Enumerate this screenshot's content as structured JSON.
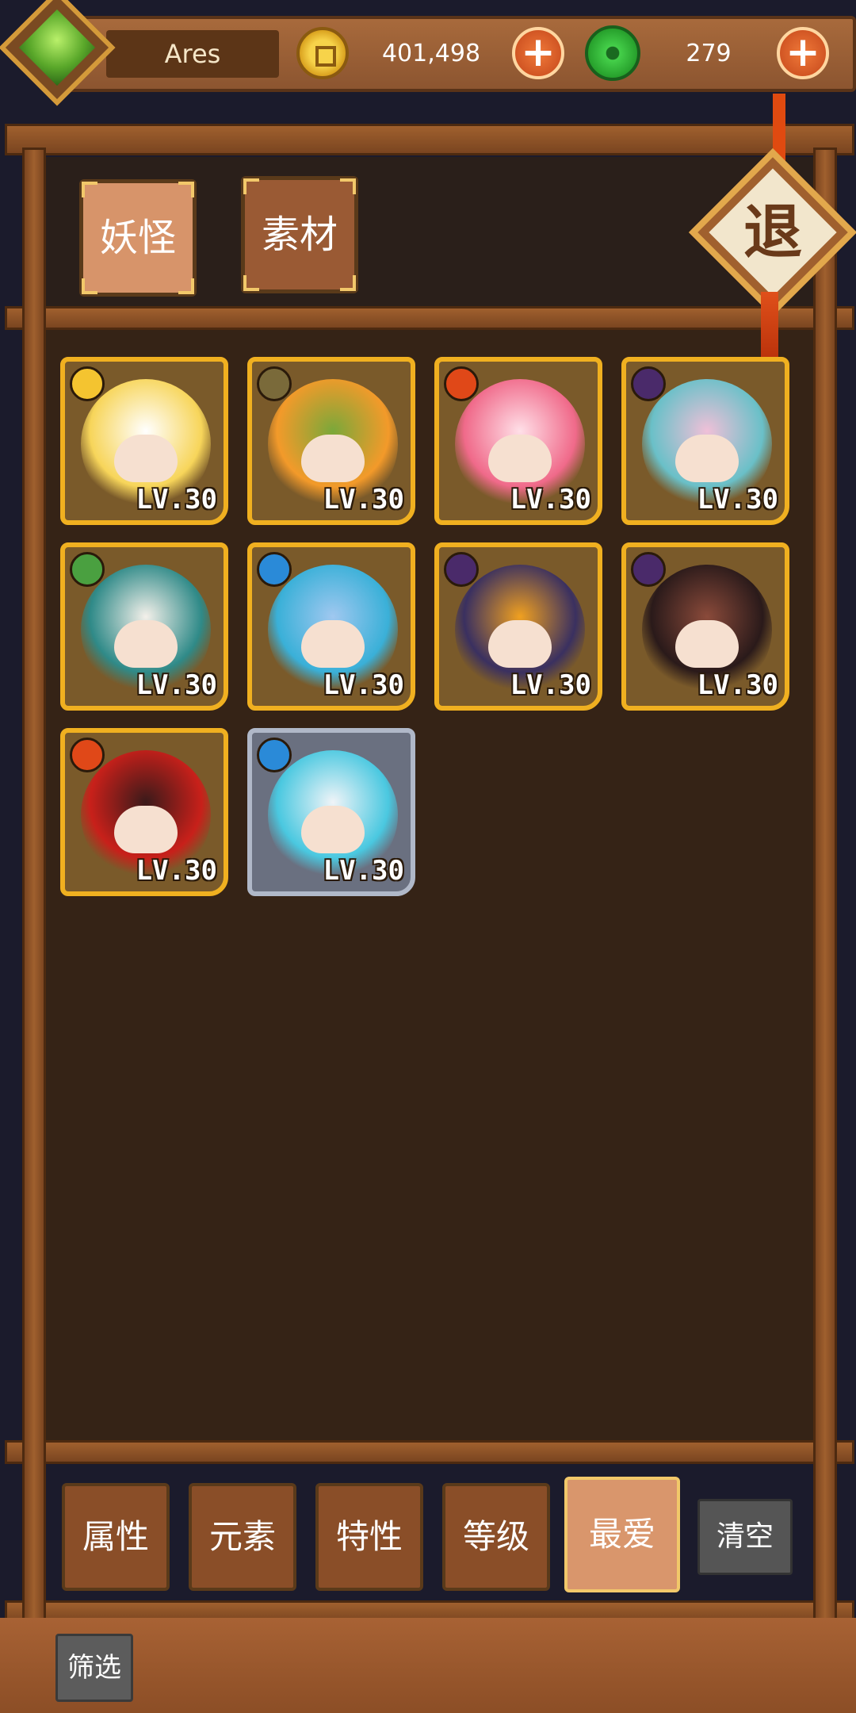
{
  "player": {
    "name": "Ares"
  },
  "currency": {
    "coins": "401,498",
    "jade": "279"
  },
  "tabs": [
    {
      "label": "妖怪"
    },
    {
      "label": "素材"
    }
  ],
  "exit_label": "退",
  "monsters": [
    {
      "element": "light",
      "element_color": "#f4c430",
      "level": "LV.30",
      "frame": "gold",
      "palette": [
        "#f7d55a",
        "#ffffff"
      ]
    },
    {
      "element": "earth",
      "element_color": "#7a6a3a",
      "level": "LV.30",
      "frame": "gold",
      "palette": [
        "#f39a2a",
        "#7aa83a"
      ]
    },
    {
      "element": "fire",
      "element_color": "#e04818",
      "level": "LV.30",
      "frame": "gold",
      "palette": [
        "#f06a8a",
        "#ffe0e8"
      ]
    },
    {
      "element": "dark",
      "element_color": "#4a2a6a",
      "level": "LV.30",
      "frame": "gold",
      "palette": [
        "#6ac0c8",
        "#f0c0d8"
      ]
    },
    {
      "element": "wood",
      "element_color": "#4aa040",
      "level": "LV.30",
      "frame": "gold",
      "palette": [
        "#2f8a88",
        "#f4f0ea"
      ]
    },
    {
      "element": "water",
      "element_color": "#2a8ad8",
      "level": "LV.30",
      "frame": "gold",
      "palette": [
        "#3ab0d8",
        "#a0c8f0"
      ]
    },
    {
      "element": "dark",
      "element_color": "#4a2a6a",
      "level": "LV.30",
      "frame": "gold",
      "palette": [
        "#3a3060",
        "#f0a020"
      ]
    },
    {
      "element": "dark",
      "element_color": "#4a2a6a",
      "level": "LV.30",
      "frame": "gold",
      "palette": [
        "#2a1a1a",
        "#8a4a3a"
      ]
    },
    {
      "element": "fire",
      "element_color": "#e04818",
      "level": "LV.30",
      "frame": "gold",
      "palette": [
        "#c8201a",
        "#3a1a1a"
      ]
    },
    {
      "element": "water",
      "element_color": "#2a8ad8",
      "level": "LV.30",
      "frame": "silver",
      "palette": [
        "#4ac8e0",
        "#f0f4f8"
      ]
    }
  ],
  "filters": [
    {
      "label": "属性"
    },
    {
      "label": "元素"
    },
    {
      "label": "特性"
    },
    {
      "label": "等级"
    },
    {
      "label": "最爱"
    }
  ],
  "clear_label": "清空",
  "screen_label": "筛选"
}
